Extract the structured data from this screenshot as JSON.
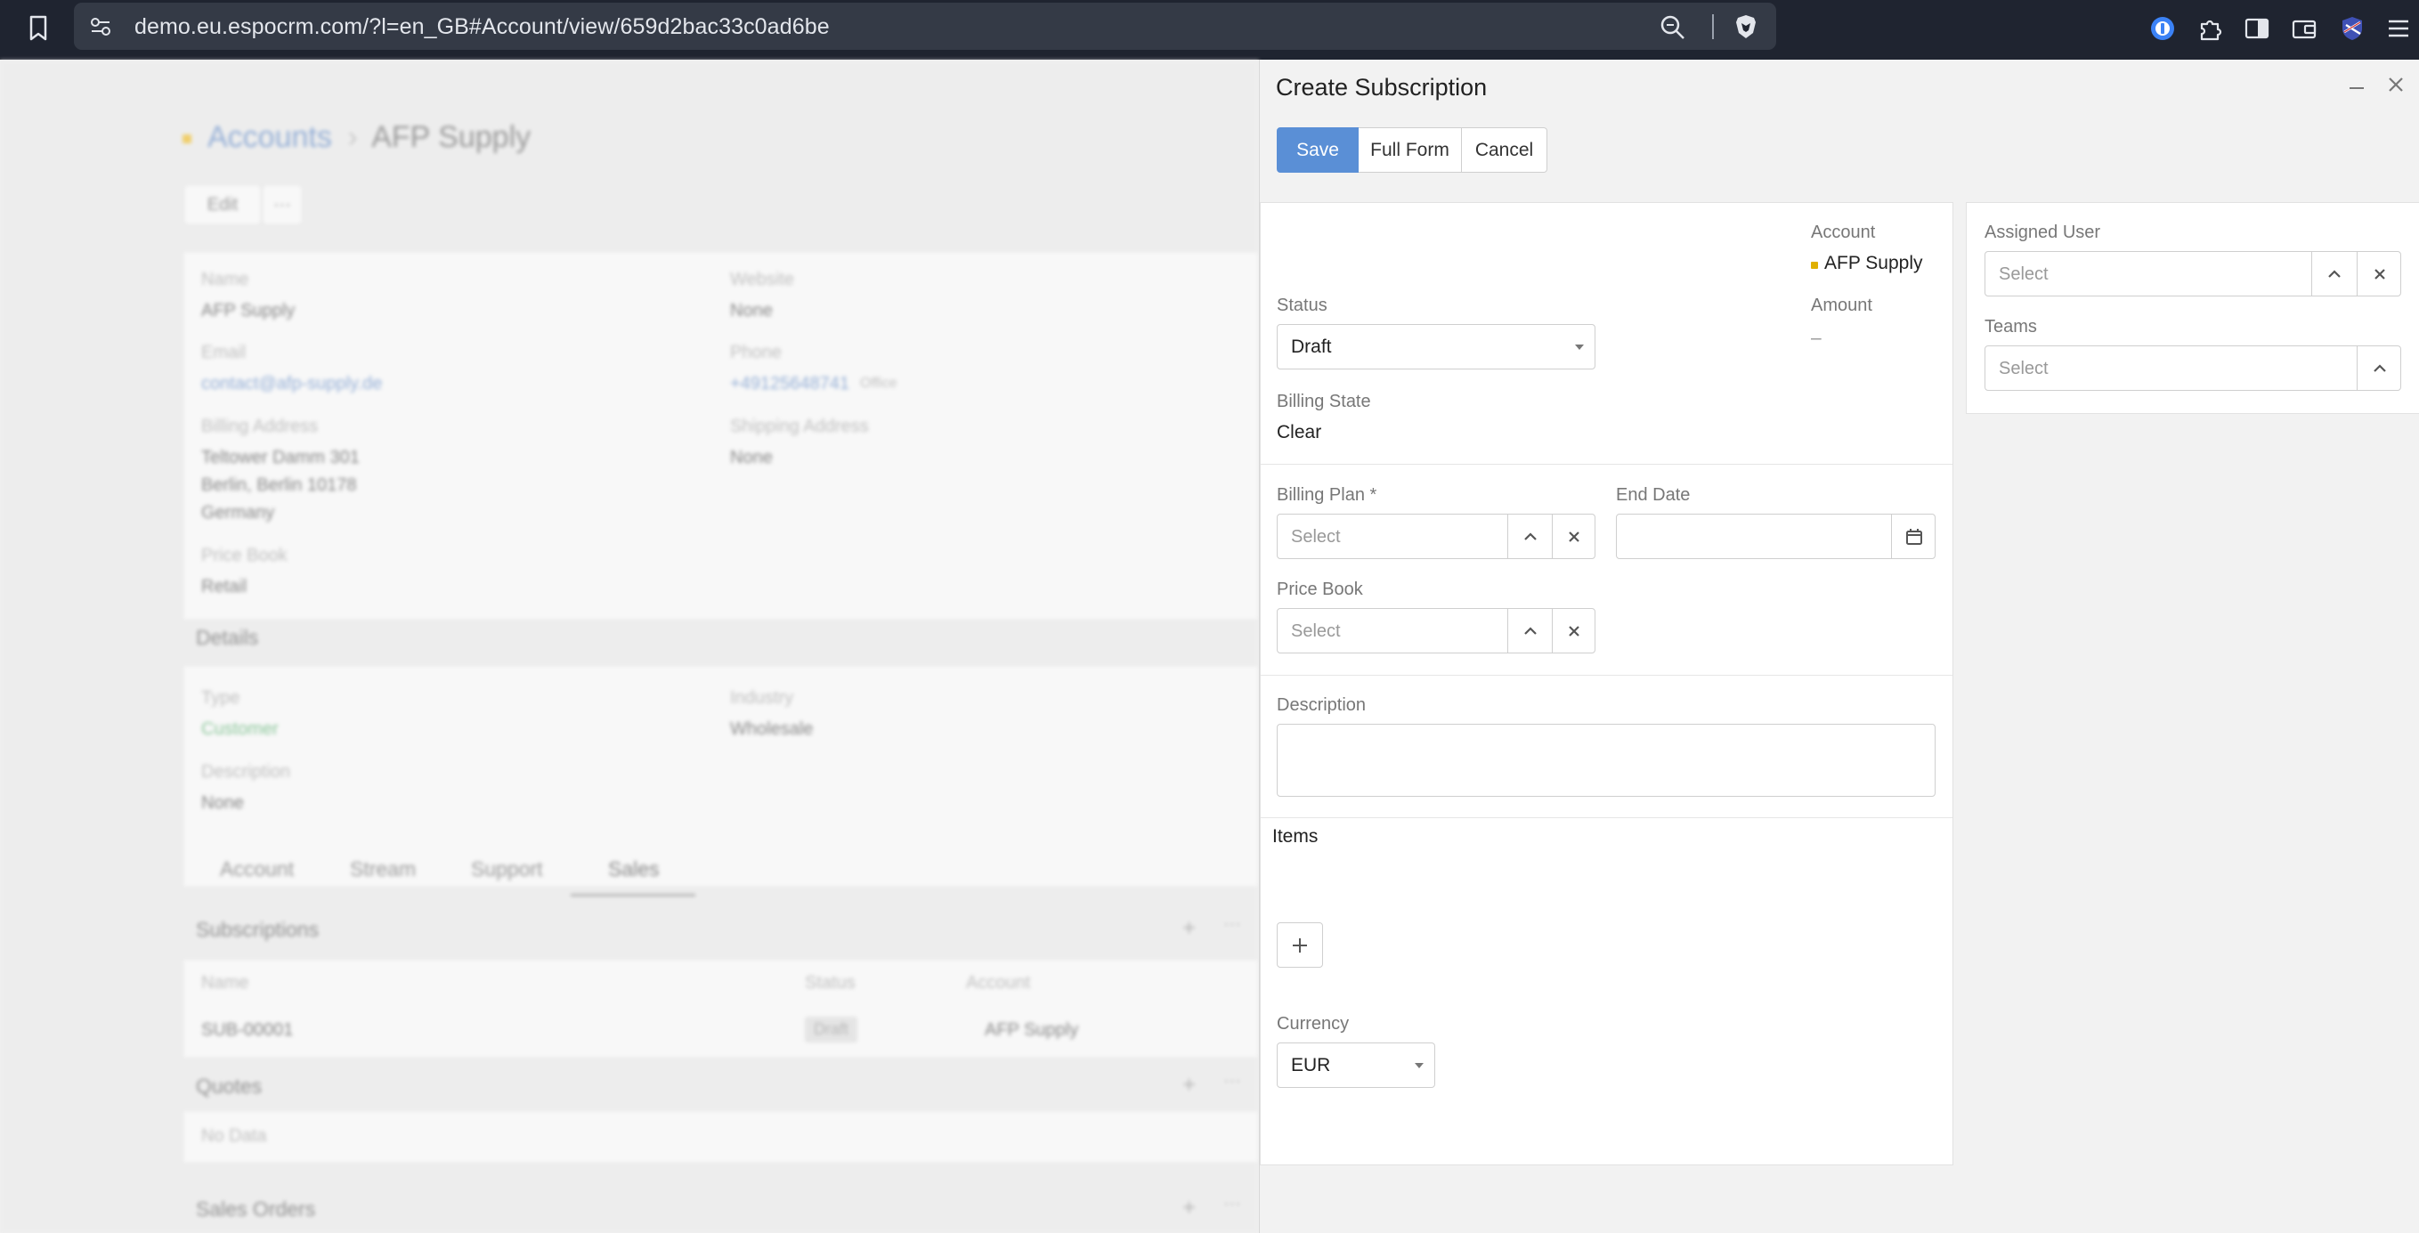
{
  "browser": {
    "url": "demo.eu.espocrm.com/?l=en_GB#Account/view/659d2bac33c0ad6be"
  },
  "background_page": {
    "breadcrumb_root": "Accounts",
    "breadcrumb_sep": "›",
    "record_title": "AFP Supply",
    "edit_label": "Edit",
    "more_label": "···",
    "fields": {
      "name_label": "Name",
      "name_value": "AFP Supply",
      "website_label": "Website",
      "website_value": "None",
      "email_label": "Email",
      "email_value": "contact@afp-supply.de",
      "phone_label": "Phone",
      "phone_value": "+49125648741",
      "phone_type": "Office",
      "billing_label": "Billing Address",
      "billing_line1": "Teltower Damm 301",
      "billing_line2": "Berlin, Berlin 10178",
      "billing_line3": "Germany",
      "shipping_label": "Shipping Address",
      "shipping_value": "None",
      "pricebook_label": "Price Book",
      "pricebook_value": "Retail"
    },
    "details": {
      "heading": "Details",
      "type_label": "Type",
      "type_value": "Customer",
      "industry_label": "Industry",
      "industry_value": "Wholesale",
      "description_label": "Description",
      "description_value": "None"
    },
    "tabs": [
      "Account",
      "Stream",
      "Support",
      "Sales"
    ],
    "subscriptions": {
      "heading": "Subscriptions",
      "col_name": "Name",
      "col_status": "Status",
      "col_account": "Account",
      "row_name": "SUB-00001",
      "row_status": "Draft",
      "row_account": "AFP Supply"
    },
    "quotes": {
      "heading": "Quotes",
      "empty": "No Data"
    },
    "sales_orders": {
      "heading": "Sales Orders"
    },
    "plus": "+",
    "dots": "···"
  },
  "modal": {
    "title": "Create Subscription",
    "buttons": {
      "save": "Save",
      "full_form": "Full Form",
      "cancel": "Cancel"
    },
    "account_label": "Account",
    "account_value": "AFP Supply",
    "status_label": "Status",
    "status_value": "Draft",
    "amount_label": "Amount",
    "amount_value": "–",
    "billing_state_label": "Billing State",
    "billing_state_value": "Clear",
    "billing_plan_label": "Billing Plan *",
    "billing_plan_placeholder": "Select",
    "end_date_label": "End Date",
    "price_book_label": "Price Book",
    "price_book_placeholder": "Select",
    "description_label": "Description",
    "items_label": "Items",
    "add_item_symbol": "+",
    "currency_label": "Currency",
    "currency_value": "EUR",
    "assigned_user_label": "Assigned User",
    "assigned_user_placeholder": "Select",
    "teams_label": "Teams",
    "teams_placeholder": "Select"
  },
  "icons": {
    "bookmark": "bookmark-icon",
    "site_info": "site-settings-icon",
    "zoom": "zoom-icon",
    "brave": "brave-shields-icon",
    "password_manager": "password-manager-icon",
    "extensions": "puzzle-icon",
    "sidebar": "sidebar-icon",
    "wallet": "wallet-icon",
    "vpn": "vpn-flag-icon",
    "menu": "hamburger-menu-icon",
    "calendar": "calendar-icon"
  },
  "colors": {
    "accent": "#5a8fd6",
    "account_dot": "#e0b000",
    "chrome_bg": "#1f2430"
  }
}
